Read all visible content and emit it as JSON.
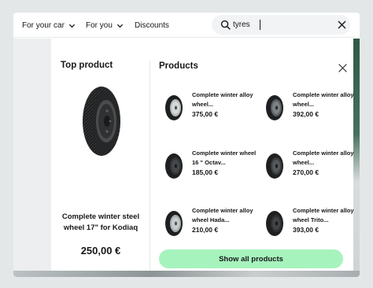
{
  "nav": {
    "items": [
      {
        "label": "For your car",
        "icon": "chevron-down-icon"
      },
      {
        "label": "For you",
        "icon": "chevron-down-icon"
      },
      {
        "label": "Discounts"
      }
    ]
  },
  "search": {
    "value": "tyres",
    "icon": "search-icon",
    "clear_icon": "close-icon"
  },
  "top_product": {
    "heading": "Top product",
    "name": "Complete winter steel wheel 17\" for Kodiaq",
    "price": "250,00 €"
  },
  "products": {
    "heading": "Products",
    "items": [
      {
        "title": "Complete winter alloy wheel...",
        "price": "375,00 €"
      },
      {
        "title": "Complete winter alloy wheel...",
        "price": "392,00 €"
      },
      {
        "title": "Complete winter wheel 16 \" Octav...",
        "price": "185,00 €"
      },
      {
        "title": "Complete winter alloy wheel...",
        "price": "270,00 €"
      },
      {
        "title": "Complete winter alloy wheel Hada...",
        "price": "210,00 €"
      },
      {
        "title": "Complete winter alloy wheel Trito...",
        "price": "393,00 €"
      }
    ],
    "show_all_label": "Show all products"
  },
  "colors": {
    "accent": "#a7f3bd",
    "text": "#161718",
    "background": "#e3e7e8"
  }
}
